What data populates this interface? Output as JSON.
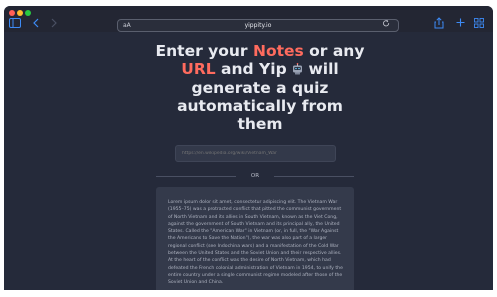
{
  "browser": {
    "url_display": "yippity.io",
    "aa_label": "aA",
    "reload_icon": "reload-icon",
    "sidebar_icon": "sidebar-icon",
    "back_icon": "chevron-left-icon",
    "forward_icon": "chevron-right-icon",
    "share_icon": "share-icon",
    "new_tab_icon": "plus-icon",
    "tabs_icon": "tabs-grid-icon",
    "traffic_lights": [
      "#ff5f57",
      "#febc2e",
      "#28c840"
    ],
    "accent_color": "#3d8bf6"
  },
  "hero": {
    "part1": "Enter your ",
    "notes_word": "Notes",
    "part2": " or any ",
    "url_word": "URL",
    "part3": " and Yip ",
    "robot_icon": "robot-icon",
    "part4": " will generate a quiz automatically from them",
    "accent_color": "#ff6b5e"
  },
  "url_input": {
    "placeholder": "https://en.wikipedia.org/wiki/Vietnam_War"
  },
  "divider": {
    "or_label": "OR"
  },
  "notes": {
    "text": "Lorem ipsum dolor sit amet, consectetur adipiscing elit. The Vietnam War (1955–75) was a protracted conflict that pitted the communist government of North Vietnam and its allies in South Vietnam, known as the Viet Cong, against the government of South Vietnam and its principal ally, the United States. Called the \"American War\" in Vietnam (or, in full, the \"War Against the Americans to Save the Nation\"), the war was also part of a larger regional conflict (see Indochina wars) and a manifestation of the Cold War between the United States and the Soviet Union and their respective allies. At the heart of the conflict was the desire of North Vietnam, which had defeated the French colonial administration of Vietnam in 1954, to unify the entire country under a single communist regime modeled after those of the Soviet Union and China."
  }
}
